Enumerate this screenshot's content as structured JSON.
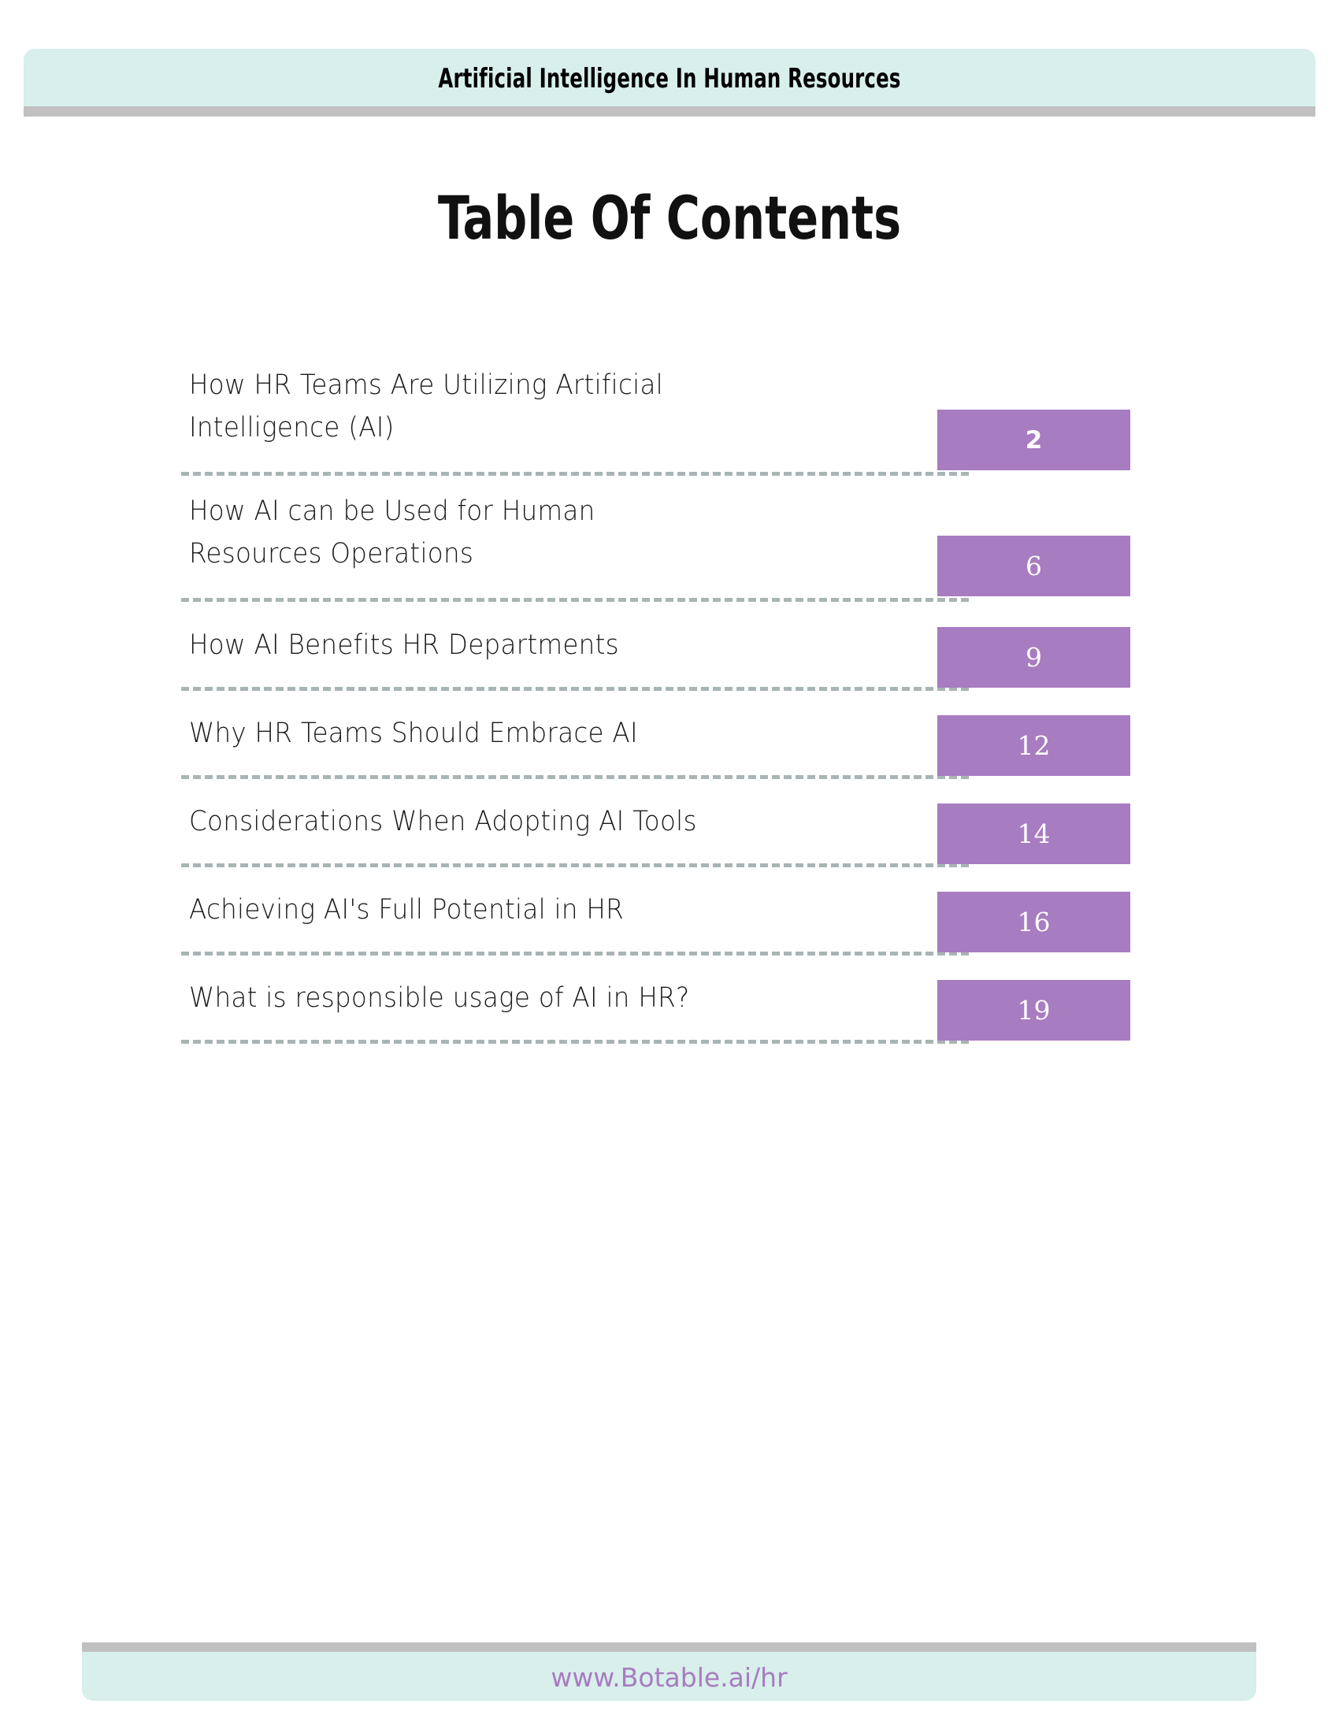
{
  "header": {
    "title": "Artificial Intelligence In Human Resources",
    "band_color": "#d8efeb",
    "rule_color": "#c0c0c0"
  },
  "page": {
    "title": "Table Of Contents",
    "background": "#ffffff"
  },
  "toc": {
    "accent_color": "#a87cc0",
    "leader_color": "#a9b4b4",
    "entries": [
      {
        "label": "How HR Teams Are Utilizing Artificial\nIntelligence (AI)",
        "page": "2",
        "lines": 2
      },
      {
        "label": "How AI can be Used for Human\nResources Operations",
        "page": "6",
        "lines": 2
      },
      {
        "label": "How AI Benefits HR Departments",
        "page": "9",
        "lines": 1
      },
      {
        "label": "Why HR Teams Should Embrace AI",
        "page": "12",
        "lines": 1
      },
      {
        "label": "Considerations When Adopting AI Tools",
        "page": "14",
        "lines": 1
      },
      {
        "label": "Achieving AI's Full Potential in HR",
        "page": "16",
        "lines": 1
      },
      {
        "label": "What is responsible usage of AI in HR?",
        "page": "19",
        "lines": 1
      }
    ]
  },
  "footer": {
    "url": "www.Botable.ai/hr",
    "band_color": "#d8efeb",
    "rule_color": "#c0c0c0",
    "url_color": "#a87cc0"
  }
}
